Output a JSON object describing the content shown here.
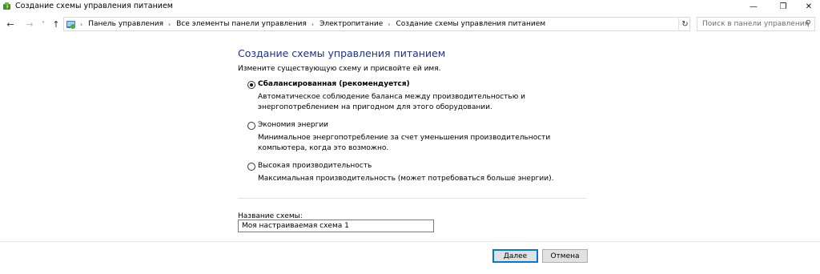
{
  "window": {
    "title": "Создание схемы управления питанием",
    "controls": {
      "minimize": "—",
      "maximize": "❐",
      "close": "✕"
    }
  },
  "nav": {
    "back_icon": "←",
    "forward_icon": "→",
    "recent_icon": "˅",
    "up_icon": "↑"
  },
  "address": {
    "breadcrumbs": [
      "Панель управления",
      "Все элементы панели управления",
      "Электропитание",
      "Создание схемы управления питанием"
    ],
    "separator": "›",
    "dropdown_icon": "˅",
    "refresh_icon": "↻"
  },
  "search": {
    "placeholder": "Поиск в панели управления",
    "icon": "⚲"
  },
  "main": {
    "heading": "Создание схемы управления питанием",
    "subheading": "Измените существующую схему и присвойте ей имя.",
    "plans": [
      {
        "name": "Сбалансированная (рекомендуется)",
        "description": "Автоматическое соблюдение баланса между производительностью и энергопотреблением на пригодном для этого оборудовании.",
        "selected": true
      },
      {
        "name": "Экономия энергии",
        "description": "Минимальное энергопотребление за счет уменьшения производительности компьютера, когда это возможно.",
        "selected": false
      },
      {
        "name": "Высокая производительность",
        "description": "Максимальная производительность (может потребоваться больше энергии).",
        "selected": false
      }
    ],
    "name_label": "Название схемы:",
    "name_value": "Моя настраиваемая схема 1"
  },
  "buttons": {
    "next": "Далее",
    "cancel": "Отмена"
  },
  "colors": {
    "heading": "#1e3287",
    "default_button_border": "#0078d7",
    "button_face": "#e1e1e1"
  }
}
